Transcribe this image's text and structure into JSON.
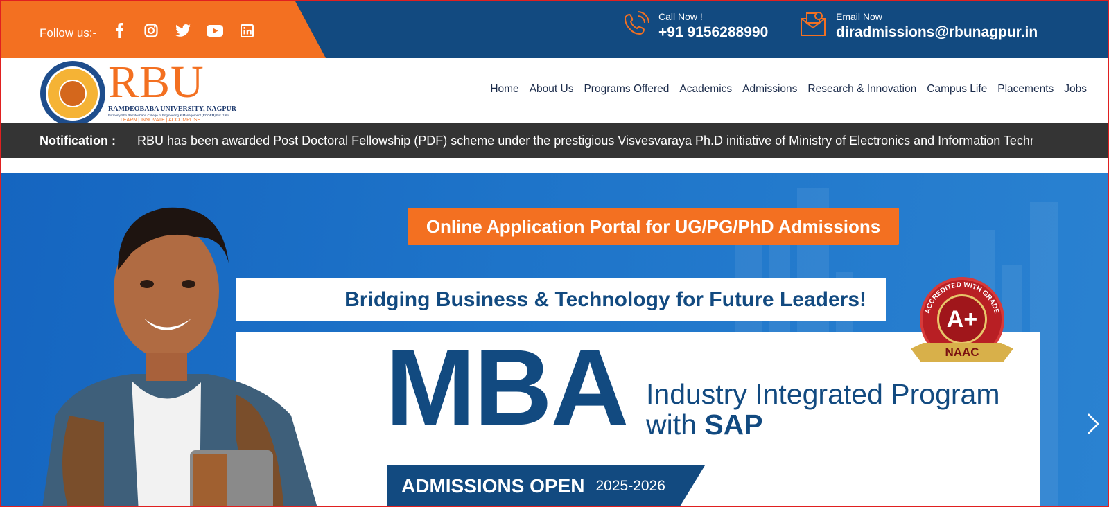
{
  "topbar": {
    "follow_label": "Follow us:-",
    "socials": [
      "facebook-icon",
      "instagram-icon",
      "twitter-icon",
      "youtube-icon",
      "linkedin-icon"
    ],
    "call_label": "Call Now !",
    "call_number": "+91 9156288990",
    "email_label": "Email Now",
    "email_address": "diradmissions@rbunagpur.in"
  },
  "brand": {
    "name": "RBU",
    "university": "RAMDEOBABA UNIVERSITY, NAGPUR",
    "formerly": "Formerly Shri Ramdeobaba College of Engineering & Management (RCOEM) Est. 1984",
    "tagline": "LEARN | INNOVATE | ACCOMPLISH"
  },
  "nav": {
    "items": [
      "Home",
      "About Us",
      "Programs Offered",
      "Academics",
      "Admissions",
      "Research & Innovation",
      "Campus Life",
      "Placements",
      "Jobs"
    ]
  },
  "notification": {
    "label": "Notification :",
    "text": "RBU has been awarded Post Doctoral Fellowship (PDF) scheme under the prestigious Visvesvaraya Ph.D initiative of Ministry of Electronics and Information Technolo"
  },
  "hero": {
    "portal_button": "Online Application Portal for UG/PG/PhD Admissions",
    "bridge_text": "Bridging Business & Technology for Future Leaders!",
    "headline": "MBA",
    "subline_1": "Industry Integrated Program",
    "subline_2_prefix": "with ",
    "subline_2_bold": "SAP",
    "admissions_label": "ADMISSIONS OPEN",
    "admissions_year": "2025-2026",
    "badge_top": "ACCREDITED WITH GRADE",
    "badge_grade": "A+",
    "badge_name": "NAAC"
  },
  "colors": {
    "orange": "#f37021",
    "navy": "#124a80",
    "hero_blue": "#1e74c9",
    "notif_bg": "#343434"
  }
}
